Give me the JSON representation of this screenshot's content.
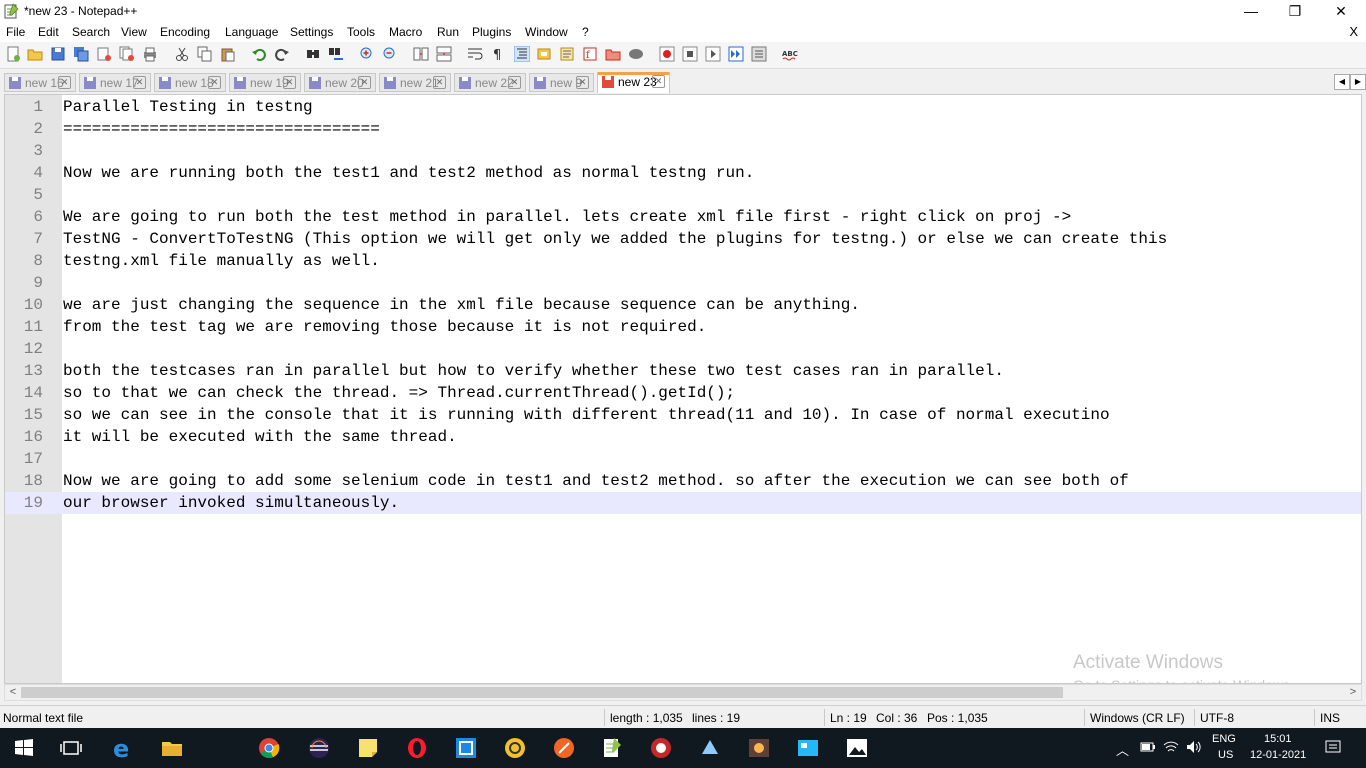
{
  "window": {
    "title": "*new 23 - Notepad++",
    "controls": {
      "minimize": "—",
      "maximize": "❐",
      "close": "✕"
    }
  },
  "menu": {
    "items": [
      "File",
      "Edit",
      "Search",
      "View",
      "Encoding",
      "Language",
      "Settings",
      "Tools",
      "Macro",
      "Run",
      "Plugins",
      "Window",
      "?"
    ],
    "close": "X"
  },
  "toolbar": {
    "icons": [
      "new-file-icon",
      "open-file-icon",
      "save-icon",
      "save-all-icon",
      "close-icon",
      "close-all-icon",
      "print-icon",
      "cut-icon",
      "copy-icon",
      "paste-icon",
      "undo-icon",
      "redo-icon",
      "find-icon",
      "replace-icon",
      "zoom-in-icon",
      "zoom-out-icon",
      "sync-v-icon",
      "sync-h-icon",
      "word-wrap-icon",
      "show-all-chars-icon",
      "indent-guide-icon",
      "udl-icon",
      "doc-map-icon",
      "function-list-icon",
      "folder-as-workspace-icon",
      "monitoring-icon",
      "record-macro-icon",
      "stop-record-icon",
      "play-macro-icon",
      "run-macro-multiple-icon",
      "save-macro-icon",
      "spell-check-icon"
    ]
  },
  "tabs": [
    {
      "label": "new 16",
      "active": false
    },
    {
      "label": "new 17",
      "active": false
    },
    {
      "label": "new 18",
      "active": false
    },
    {
      "label": "new 19",
      "active": false
    },
    {
      "label": "new 20",
      "active": false
    },
    {
      "label": "new 21",
      "active": false
    },
    {
      "label": "new 22",
      "active": false
    },
    {
      "label": "new 9",
      "active": false
    },
    {
      "label": "new 23",
      "active": true
    }
  ],
  "editor": {
    "current_line": 19,
    "lines": [
      "Parallel Testing in testng",
      "=================================",
      "",
      "Now we are running both the test1 and test2 method as normal testng run.",
      "",
      "We are going to run both the test method in parallel. lets create xml file first - right click on proj ->",
      "TestNG - ConvertToTestNG (This option we will get only we added the plugins for testng.) or else we can create this",
      "testng.xml file manually as well.",
      "",
      "we are just changing the sequence in the xml file because sequence can be anything.",
      "from the test tag we are removing those because it is not required.",
      "",
      "both the testcases ran in parallel but how to verify whether these two test cases ran in parallel.",
      "so to that we can check the thread. => Thread.currentThread().getId();",
      "so we can see in the console that it is running with different thread(11 and 10). In case of normal executino",
      "it will be executed with the same thread.",
      "",
      "Now we are going to add some selenium code in test1 and test2 method. so after the execution we can see both of",
      "our browser invoked simultaneously."
    ]
  },
  "watermark": {
    "line1": "Activate Windows",
    "line2": "Go to Settings to activate Windows."
  },
  "status": {
    "file_type": "Normal text file",
    "length": "length : 1,035",
    "lines": "lines : 19",
    "ln": "Ln : 19",
    "col": "Col : 36",
    "pos": "Pos : 1,035",
    "eol": "Windows (CR LF)",
    "encoding": "UTF-8",
    "mode": "INS"
  },
  "taskbar": {
    "apps": [
      "start-icon",
      "task-view-icon",
      "edge-icon",
      "file-explorer-icon",
      "chrome-icon",
      "eclipse-icon",
      "sticky-notes-icon",
      "opera-icon",
      "app-icon",
      "app-icon-2",
      "app-icon-3",
      "notepadpp-icon",
      "app-icon-4",
      "app-icon-5",
      "app-icon-6",
      "app-icon-7",
      "photos-icon"
    ],
    "lang": "ENG",
    "region": "US",
    "time": "15:01",
    "date": "12-01-2021"
  }
}
